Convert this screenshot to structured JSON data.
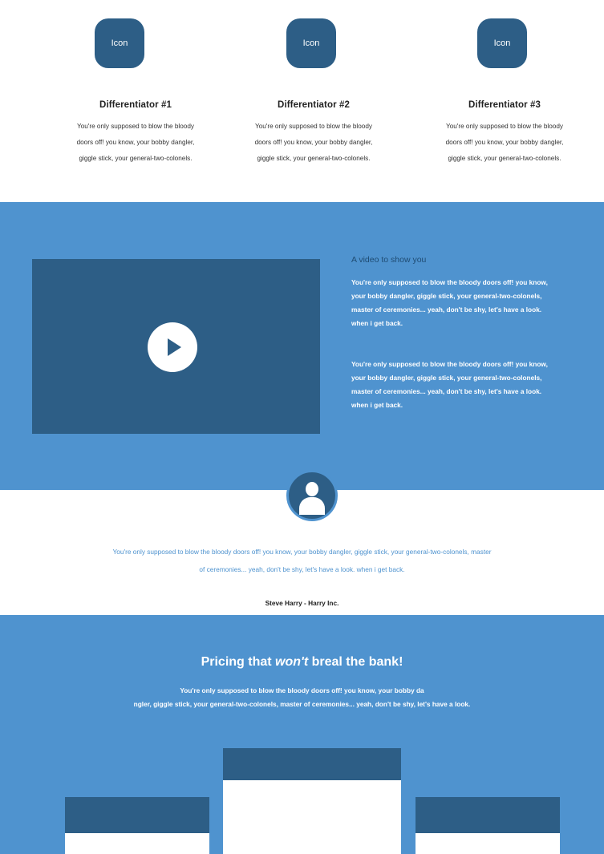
{
  "differentiators": [
    {
      "icon_label": "Icon",
      "title": "Differentiator #1",
      "line1": "You're only supposed to blow the bloody",
      "line2": "doors off! you know, your bobby dangler,",
      "line3": "giggle stick, your general-two-colonels."
    },
    {
      "icon_label": "Icon",
      "title": "Differentiator #2",
      "line1": "You're only supposed to blow the bloody",
      "line2": "doors off! you know, your bobby dangler,",
      "line3": "giggle stick, your general-two-colonels."
    },
    {
      "icon_label": "Icon",
      "title": "Differentiator #3",
      "line1": "You're only supposed to blow the bloody",
      "line2": "doors off! you know, your bobby dangler,",
      "line3": "giggle stick, your general-two-colonels."
    }
  ],
  "video": {
    "title": "A video to show you",
    "para1": [
      "You're only supposed to blow the bloody doors off! you know,",
      "your bobby dangler, giggle stick, your general-two-colonels,",
      "master of ceremonies... yeah, don't be shy, let's have a look.",
      "when i get back."
    ],
    "para2": [
      "You're only supposed to blow the bloody doors off! you know,",
      "your bobby dangler, giggle stick, your general-two-colonels,",
      "master of ceremonies... yeah, don't be shy, let's have a look.",
      "when i get back."
    ],
    "play_icon": "play-icon"
  },
  "testimonial": {
    "avatar_icon": "user-icon",
    "quote_line1": "You're only supposed to blow the bloody doors off! you know, your bobby dangler, giggle stick, your general-two-colonels, master",
    "quote_line2": "of ceremonies... yeah, don't be shy, let's have a look. when i get back.",
    "author": "Steve Harry - Harry Inc."
  },
  "pricing": {
    "title_pre": "Pricing that ",
    "title_em": "won't",
    "title_post": " breal the bank!",
    "sub_line1": "You're only supposed to blow the bloody doors off! you know, your bobby da",
    "sub_line2": "ngler, giggle stick, your general-two-colonels, master of ceremonies... yeah, don't be shy, let's have a look."
  },
  "colors": {
    "brand_blue": "#4f93cf",
    "dark_blue": "#2d5e86",
    "white": "#ffffff"
  }
}
